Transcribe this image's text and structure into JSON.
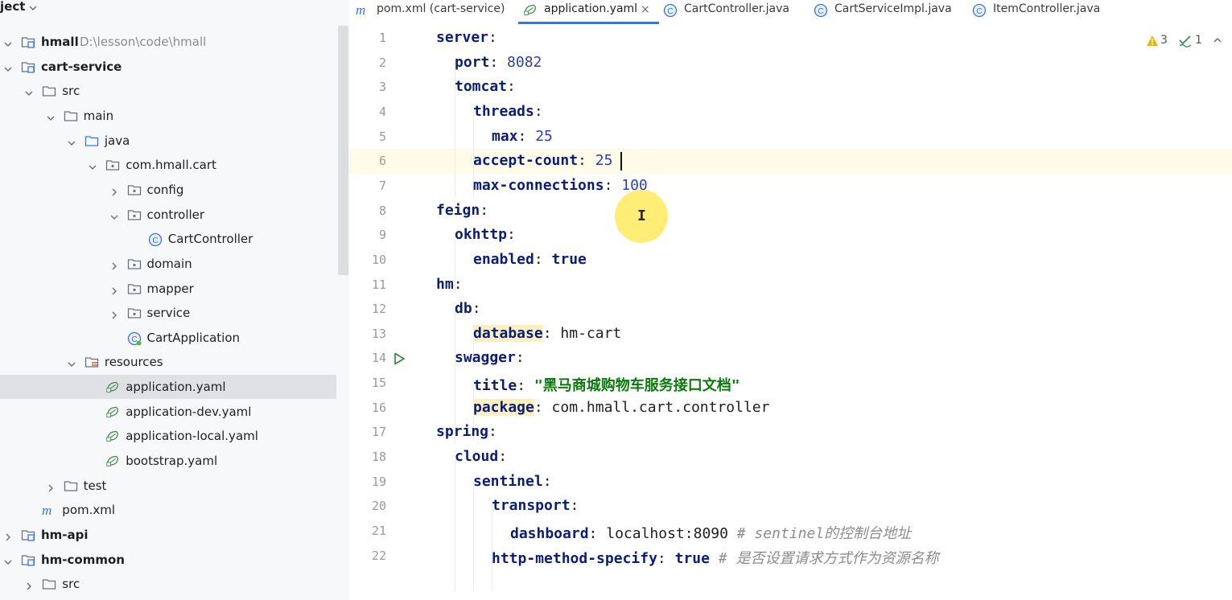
{
  "project_panel": {
    "title": "ject",
    "root": {
      "name": "hmall",
      "path": "D:\\lesson\\code\\hmall"
    },
    "tree": [
      {
        "label": "hmall",
        "path": "D:\\lesson\\code\\hmall",
        "icon": "module-folder-icon",
        "expanded": true,
        "bold": true
      },
      {
        "label": "cart-service",
        "icon": "module-folder-icon",
        "expanded": true,
        "bold": true
      },
      {
        "label": "src",
        "icon": "folder-icon",
        "expanded": true
      },
      {
        "label": "main",
        "icon": "folder-icon",
        "expanded": true
      },
      {
        "label": "java",
        "icon": "source-folder-icon",
        "expanded": true
      },
      {
        "label": "com.hmall.cart",
        "icon": "package-icon",
        "expanded": true
      },
      {
        "label": "config",
        "icon": "package-icon",
        "expanded": false
      },
      {
        "label": "controller",
        "icon": "package-icon",
        "expanded": true
      },
      {
        "label": "CartController",
        "icon": "class-icon"
      },
      {
        "label": "domain",
        "icon": "package-icon",
        "expanded": false
      },
      {
        "label": "mapper",
        "icon": "package-icon",
        "expanded": false
      },
      {
        "label": "service",
        "icon": "package-icon",
        "expanded": false
      },
      {
        "label": "CartApplication",
        "icon": "spring-class-icon"
      },
      {
        "label": "resources",
        "icon": "resources-folder-icon",
        "expanded": true
      },
      {
        "label": "application.yaml",
        "icon": "spring-config-icon",
        "selected": true
      },
      {
        "label": "application-dev.yaml",
        "icon": "spring-config-icon"
      },
      {
        "label": "application-local.yaml",
        "icon": "spring-config-icon"
      },
      {
        "label": "bootstrap.yaml",
        "icon": "spring-config-icon"
      },
      {
        "label": "test",
        "icon": "folder-icon",
        "expanded": false
      },
      {
        "label": "pom.xml",
        "icon": "maven-icon"
      },
      {
        "label": "hm-api",
        "icon": "module-folder-icon",
        "expanded": false,
        "bold": true
      },
      {
        "label": "hm-common",
        "icon": "module-folder-icon",
        "expanded": true,
        "bold": true
      },
      {
        "label": "src",
        "icon": "folder-icon",
        "expanded": false
      }
    ]
  },
  "tabs": [
    {
      "label": "pom.xml (cart-service)",
      "icon": "maven-icon"
    },
    {
      "label": "application.yaml",
      "icon": "spring-config-icon",
      "active": true,
      "close": "×"
    },
    {
      "label": "CartController.java",
      "icon": "class-icon"
    },
    {
      "label": "CartServiceImpl.java",
      "icon": "class-icon"
    },
    {
      "label": "ItemController.java",
      "icon": "class-icon"
    }
  ],
  "editor": {
    "file": "application.yaml",
    "current_line": 6,
    "inspections": {
      "warnings": "3",
      "weak_warnings": "1"
    },
    "line_numbers": [
      "1",
      "2",
      "3",
      "4",
      "5",
      "6",
      "7",
      "8",
      "9",
      "10",
      "11",
      "12",
      "13",
      "14",
      "15",
      "16",
      "17",
      "18",
      "19",
      "20",
      "21",
      "22"
    ],
    "lines": [
      {
        "indent": 0,
        "key": "server",
        "sep": ":"
      },
      {
        "indent": 1,
        "key": "port",
        "sep": ": ",
        "value": "8082",
        "vtype": "number"
      },
      {
        "indent": 1,
        "key": "tomcat",
        "sep": ":"
      },
      {
        "indent": 2,
        "key": "threads",
        "sep": ":"
      },
      {
        "indent": 3,
        "key": "max",
        "sep": ": ",
        "value": "25",
        "vtype": "number"
      },
      {
        "indent": 2,
        "key": "accept-count",
        "sep": ": ",
        "value": "25",
        "vtype": "number"
      },
      {
        "indent": 2,
        "key": "max-connections",
        "sep": ": ",
        "value": "100",
        "vtype": "number"
      },
      {
        "indent": 0,
        "key": "feign",
        "sep": ":"
      },
      {
        "indent": 1,
        "key": "okhttp",
        "sep": ":"
      },
      {
        "indent": 2,
        "key": "enabled",
        "sep": ": ",
        "value": "true",
        "vtype": "keyword"
      },
      {
        "indent": 0,
        "key": "hm",
        "sep": ":"
      },
      {
        "indent": 1,
        "key": "db",
        "sep": ":"
      },
      {
        "indent": 2,
        "key": "database",
        "sep": ": ",
        "value": "hm-cart",
        "vtype": "plain",
        "highlight": true
      },
      {
        "indent": 1,
        "key": "swagger",
        "sep": ":"
      },
      {
        "indent": 2,
        "key": "title",
        "sep": ": ",
        "value": "\"黑马商城购物车服务接口文档\"",
        "vtype": "string"
      },
      {
        "indent": 2,
        "key": "package",
        "sep": ": ",
        "value": "com.hmall.cart.controller",
        "vtype": "plain",
        "highlight": true
      },
      {
        "indent": 0,
        "key": "spring",
        "sep": ":"
      },
      {
        "indent": 1,
        "key": "cloud",
        "sep": ":"
      },
      {
        "indent": 2,
        "key": "sentinel",
        "sep": ":"
      },
      {
        "indent": 3,
        "key": "transport",
        "sep": ":"
      },
      {
        "indent": 4,
        "key": "dashboard",
        "sep": ": ",
        "value": "localhost:8090",
        "vtype": "plain",
        "comment": " # sentinel的控制台地址"
      },
      {
        "indent": 3,
        "key": "http-method-specify",
        "sep": ": ",
        "value": "true",
        "vtype": "keyword",
        "comment": " # 是否设置请求方式作为资源名称"
      }
    ]
  }
}
